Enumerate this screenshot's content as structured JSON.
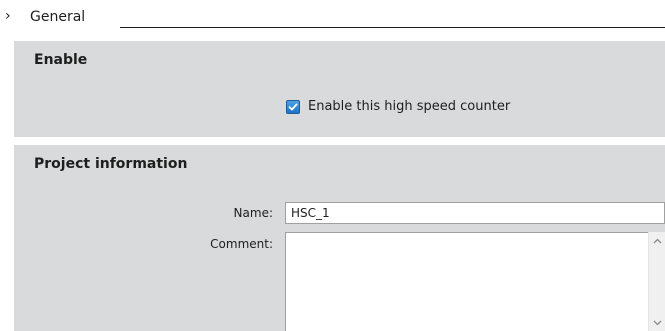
{
  "general": {
    "arrow": "›",
    "label": "General"
  },
  "enable": {
    "title": "Enable",
    "checkbox_label": "Enable this high speed counter",
    "checked": true
  },
  "project": {
    "title": "Project information",
    "name_label": "Name:",
    "name_value": "HSC_1",
    "comment_label": "Comment:",
    "comment_value": ""
  },
  "colors": {
    "section_bg": "#d9dadb",
    "checkbox_fill": "#1a73c9"
  }
}
